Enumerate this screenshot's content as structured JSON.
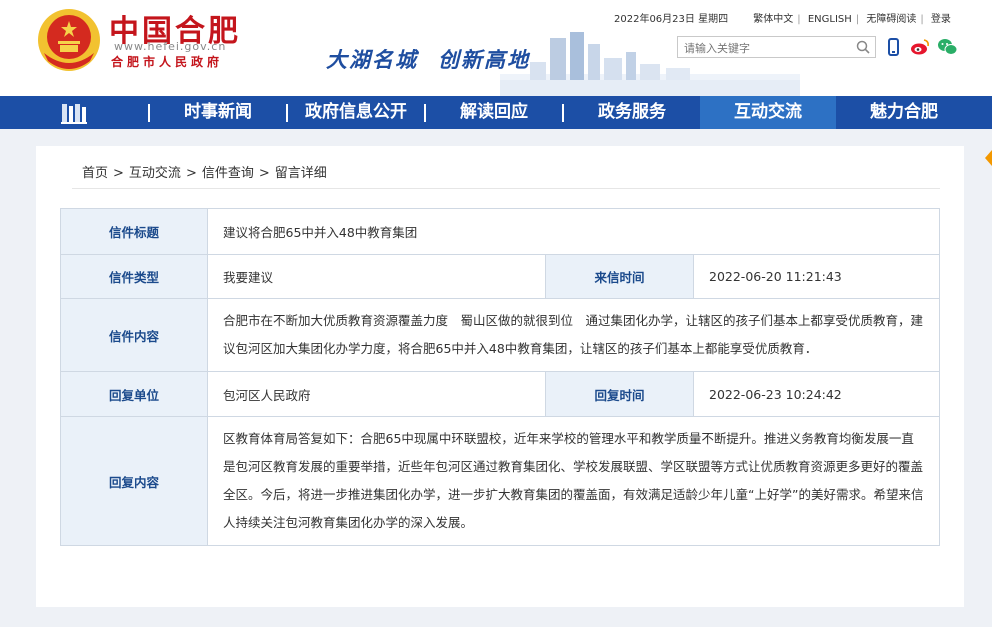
{
  "header": {
    "logo_title": "中国合肥",
    "logo_url": "www.hefei.gov.cn",
    "logo_sub": "合肥市人民政府",
    "slogan_part1": "大湖名城",
    "slogan_part2": "创新高地",
    "date": "2022年06月23日 星期四",
    "links": [
      "繁体中文",
      "ENGLISH",
      "无障碍阅读",
      "登录"
    ],
    "search_placeholder": "请输入关键字",
    "brand_color": "#c4151c"
  },
  "nav": {
    "home_icon": "library-icon",
    "items": [
      "时事新闻",
      "政府信息公开",
      "解读回应",
      "政务服务",
      "互动交流",
      "魅力合肥"
    ],
    "active": "互动交流",
    "bg_color": "#1c4fa6"
  },
  "breadcrumb": [
    "首页",
    "互动交流",
    "信件查询",
    "留言详细"
  ],
  "letter": {
    "title_label": "信件标题",
    "title": "建议将合肥65中并入48中教育集团",
    "type_label": "信件类型",
    "type": "我要建议",
    "time_label": "来信时间",
    "time": "2022-06-20 11:21:43",
    "content_label": "信件内容",
    "content": "合肥市在不断加大优质教育资源覆盖力度　蜀山区做的就很到位　通过集团化办学，让辖区的孩子们基本上都享受优质教育，建议包河区加大集团化办学力度，将合肥65中并入48中教育集团，让辖区的孩子们基本上都能享受优质教育．",
    "reply_unit_label": "回复单位",
    "reply_unit": "包河区人民政府",
    "reply_time_label": "回复时间",
    "reply_time": "2022-06-23 10:24:42",
    "reply_content_label": "回复内容",
    "reply_content": "区教育体育局答复如下：合肥65中现属中环联盟校，近年来学校的管理水平和教学质量不断提升。推进义务教育均衡发展一直是包河区教育发展的重要举措，近些年包河区通过教育集团化、学校发展联盟、学区联盟等方式让优质教育资源更多更好的覆盖全区。今后，将进一步推进集团化办学，进一步扩大教育集团的覆盖面，有效满足适龄少年儿童“上好学”的美好需求。希望来信人持续关注包河教育集团化办学的深入发展。"
  }
}
